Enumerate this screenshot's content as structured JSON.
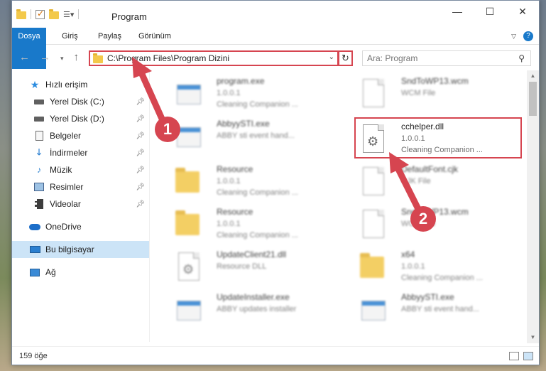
{
  "window": {
    "title": "Program"
  },
  "ribbon": {
    "tabs": [
      "Dosya",
      "Giriş",
      "Paylaş",
      "Görünüm"
    ]
  },
  "address": {
    "path": "C:\\Program Files\\Program Dizini",
    "search_placeholder": "Ara: Program"
  },
  "sidebar": {
    "items": [
      {
        "label": "Hızlı erişim",
        "icon": "star-icon"
      },
      {
        "label": "Yerel Disk (C:)",
        "icon": "drive-icon",
        "pinned": true
      },
      {
        "label": "Yerel Disk (D:)",
        "icon": "drive-icon",
        "pinned": true
      },
      {
        "label": "Belgeler",
        "icon": "document-icon",
        "pinned": true
      },
      {
        "label": "İndirmeler",
        "icon": "download-icon",
        "pinned": true
      },
      {
        "label": "Müzik",
        "icon": "music-icon",
        "pinned": true
      },
      {
        "label": "Resimler",
        "icon": "pictures-icon",
        "pinned": true
      },
      {
        "label": "Videolar",
        "icon": "video-icon",
        "pinned": true
      },
      {
        "label": "OneDrive",
        "icon": "cloud-icon"
      },
      {
        "label": "Bu bilgisayar",
        "icon": "computer-icon",
        "selected": true
      },
      {
        "label": "Ağ",
        "icon": "network-icon"
      }
    ]
  },
  "files": [
    {
      "name": "program.exe",
      "line1": "1.0.0.1",
      "line2": "Cleaning Companion ...",
      "icon": "exe-icon"
    },
    {
      "name": "SndToWP13.wcm",
      "line1": "WCM File",
      "line2": "",
      "icon": "file-icon"
    },
    {
      "name": "AbbyySTI.exe",
      "line1": "ABBY sti event hand...",
      "line2": "",
      "icon": "app-icon"
    },
    {
      "name": "cchelper.dll",
      "line1": "1.0.0.1",
      "line2": "Cleaning Companion ...",
      "icon": "dll-gear-icon"
    },
    {
      "name": "Resource",
      "line1": "1.0.0.1",
      "line2": "Cleaning Companion ...",
      "icon": "folder-icon"
    },
    {
      "name": "DefaultFont.cjk",
      "line1": "CJK File",
      "line2": "",
      "icon": "file-icon"
    },
    {
      "name": "Resource",
      "line1": "1.0.0.1",
      "line2": "Cleaning Companion ...",
      "icon": "folder-icon"
    },
    {
      "name": "SndToWP13.wcm",
      "line1": "WCM File",
      "line2": "",
      "icon": "file-icon"
    },
    {
      "name": "UpdateClient21.dll",
      "line1": "Resource DLL",
      "line2": "",
      "icon": "dll-gear-icon"
    },
    {
      "name": "x64",
      "line1": "1.0.0.1",
      "line2": "Cleaning Companion ...",
      "icon": "folder-icon"
    },
    {
      "name": "UpdateInstaller.exe",
      "line1": "ABBY updates installer",
      "line2": "",
      "icon": "app-icon"
    },
    {
      "name": "AbbyySTI.exe",
      "line1": "ABBY sti event hand...",
      "line2": "",
      "icon": "app-icon"
    }
  ],
  "callouts": [
    "1",
    "2"
  ],
  "status": {
    "item_count": "159 öğe"
  },
  "colors": {
    "accent": "#1979ca",
    "highlight": "#d64550"
  }
}
